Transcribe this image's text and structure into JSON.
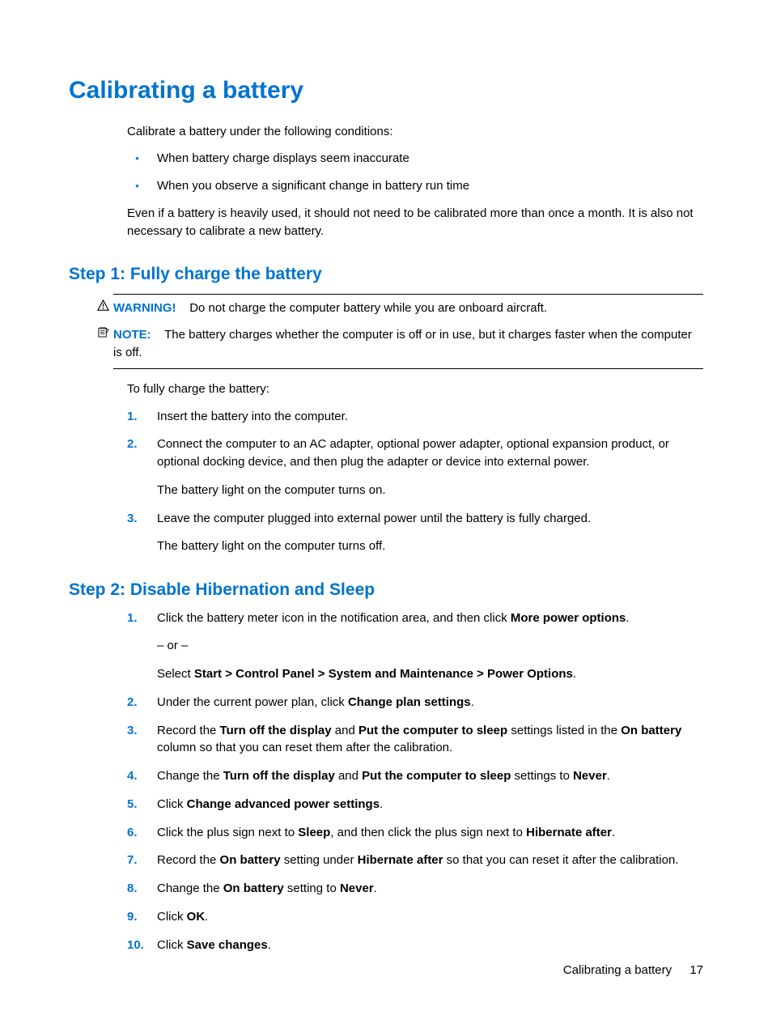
{
  "title": "Calibrating a battery",
  "intro": {
    "lead": "Calibrate a battery under the following conditions:",
    "bullets": [
      "When battery charge displays seem inaccurate",
      "When you observe a significant change in battery run time"
    ],
    "after": "Even if a battery is heavily used, it should not need to be calibrated more than once a month. It is also not necessary to calibrate a new battery."
  },
  "step1": {
    "heading": "Step 1: Fully charge the battery",
    "warning": {
      "label": "WARNING!",
      "text": "Do not charge the computer battery while you are onboard aircraft."
    },
    "note": {
      "label": "NOTE:",
      "text": "The battery charges whether the computer is off or in use, but it charges faster when the computer is off."
    },
    "lead": "To fully charge the battery:",
    "items": [
      {
        "n": "1.",
        "html": "Insert the battery into the computer."
      },
      {
        "n": "2.",
        "html": "Connect the computer to an AC adapter, optional power adapter, optional expansion product, or optional docking device, and then plug the adapter or device into external power.",
        "sub": "The battery light on the computer turns on."
      },
      {
        "n": "3.",
        "html": "Leave the computer plugged into external power until the battery is fully charged.",
        "sub": "The battery light on the computer turns off."
      }
    ]
  },
  "step2": {
    "heading": "Step 2: Disable Hibernation and Sleep",
    "items": [
      {
        "n": "1.",
        "html": "Click the battery meter icon in the notification area, and then click <b>More power options</b>.",
        "sub": "– or –",
        "sub2": "Select <b>Start > Control Panel > System and Maintenance > Power Options</b>."
      },
      {
        "n": "2.",
        "html": "Under the current power plan, click <b>Change plan settings</b>."
      },
      {
        "n": "3.",
        "html": "Record the <b>Turn off the display</b> and <b>Put the computer to sleep</b> settings listed in the <b>On battery</b> column so that you can reset them after the calibration."
      },
      {
        "n": "4.",
        "html": "Change the <b>Turn off the display</b> and <b>Put the computer to sleep</b> settings to <b>Never</b>."
      },
      {
        "n": "5.",
        "html": "Click <b>Change advanced power settings</b>."
      },
      {
        "n": "6.",
        "html": "Click the plus sign next to <b>Sleep</b>, and then click the plus sign next to <b>Hibernate after</b>."
      },
      {
        "n": "7.",
        "html": "Record the <b>On battery</b> setting under <b>Hibernate after</b> so that you can reset it after the calibration."
      },
      {
        "n": "8.",
        "html": "Change the <b>On battery</b> setting to <b>Never</b>."
      },
      {
        "n": "9.",
        "html": "Click <b>OK</b>."
      },
      {
        "n": "10.",
        "html": "Click <b>Save changes</b>."
      }
    ]
  },
  "footer": {
    "title": "Calibrating a battery",
    "page": "17"
  }
}
